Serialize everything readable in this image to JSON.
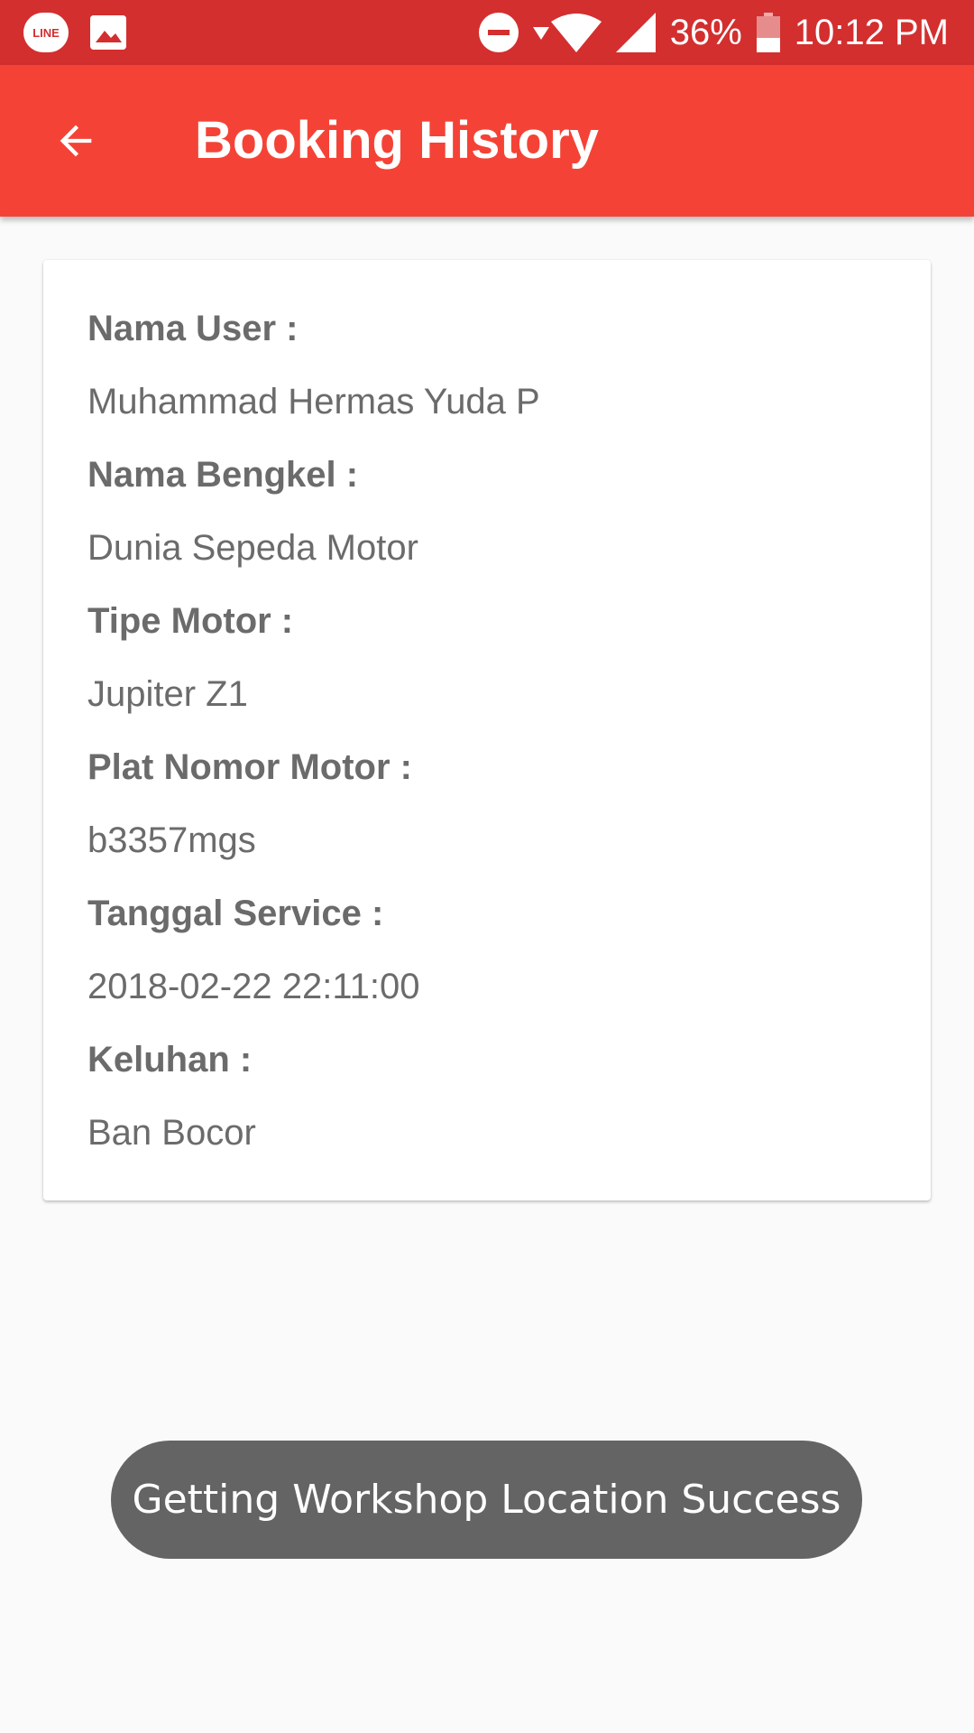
{
  "status_bar": {
    "battery": "36%",
    "time": "10:12 PM",
    "line_app_label": "LINE",
    "icons": [
      "line-icon",
      "gallery-icon",
      "do-not-disturb-icon",
      "data-arrow-icon",
      "wifi-icon",
      "signal-icon",
      "battery-icon"
    ]
  },
  "app_bar": {
    "title": "Booking History",
    "back_icon": "arrow-back-icon",
    "color": "#F44336"
  },
  "booking": {
    "fields": [
      {
        "label": "Nama User :",
        "value": "Muhammad Hermas Yuda P"
      },
      {
        "label": "Nama Bengkel :",
        "value": "Dunia Sepeda Motor"
      },
      {
        "label": "Tipe Motor :",
        "value": "Jupiter Z1"
      },
      {
        "label": "Plat Nomor Motor :",
        "value": "b3357mgs"
      },
      {
        "label": "Tanggal Service :",
        "value": "2018-02-22 22:11:00"
      },
      {
        "label": "Keluhan :",
        "value": "Ban Bocor"
      }
    ]
  },
  "toast": {
    "message": "Getting Workshop Location Success"
  },
  "colors": {
    "status_bar": "#D32F2F",
    "app_bar": "#F44336",
    "background": "#FAFAFA",
    "text": "#6b6b6b",
    "toast": "#646464"
  }
}
